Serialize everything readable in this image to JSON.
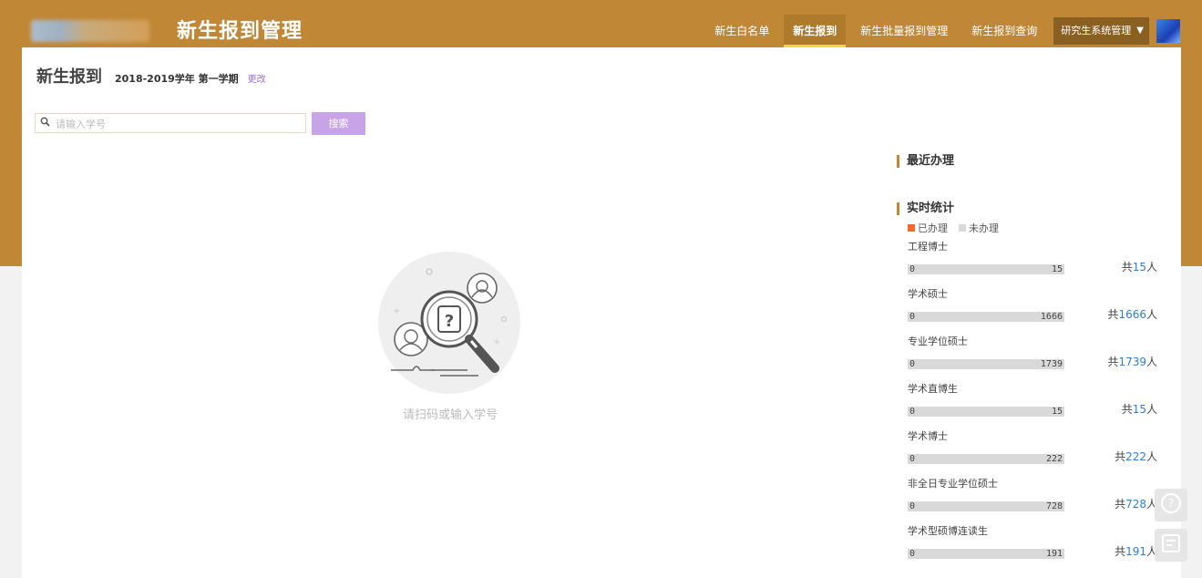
{
  "header": {
    "app_title": "新生报到管理",
    "nav": [
      {
        "label": "新生白名单",
        "active": false
      },
      {
        "label": "新生报到",
        "active": true
      },
      {
        "label": "新生批量报到管理",
        "active": false
      },
      {
        "label": "新生报到查询",
        "active": false
      }
    ],
    "user_menu": "研究生系统管理",
    "user_caret": "▼"
  },
  "page": {
    "title": "新生报到",
    "term": "2018-2019学年 第一学期",
    "change_link": "更改"
  },
  "search": {
    "placeholder": "请输入学号",
    "value": "",
    "button": "搜索"
  },
  "empty_hint": "请扫码或输入学号",
  "side": {
    "recent_title": "最近办理",
    "stats_title": "实时统计",
    "legend": {
      "done": "已办理",
      "todo": "未办理"
    },
    "total_prefix": "共",
    "total_suffix": "人",
    "categories": [
      {
        "name": "工程博士",
        "done": 0,
        "todo": 15,
        "total": 15
      },
      {
        "name": "学术硕士",
        "done": 0,
        "todo": 1666,
        "total": 1666
      },
      {
        "name": "专业学位硕士",
        "done": 0,
        "todo": 1739,
        "total": 1739
      },
      {
        "name": "学术直博生",
        "done": 0,
        "todo": 15,
        "total": 15
      },
      {
        "name": "学术博士",
        "done": 0,
        "todo": 222,
        "total": 222
      },
      {
        "name": "非全日专业学位硕士",
        "done": 0,
        "todo": 728,
        "total": 728
      },
      {
        "name": "学术型硕博连读生",
        "done": 0,
        "todo": 191,
        "total": 191
      }
    ]
  },
  "colors": {
    "brand": "#c08736",
    "done": "#ef6c2a",
    "todo": "#d9d9d9",
    "link": "#2f7fd0",
    "search_button": "#c9a3e8"
  },
  "float_buttons": [
    {
      "icon": "help-icon"
    },
    {
      "icon": "feedback-icon"
    }
  ]
}
